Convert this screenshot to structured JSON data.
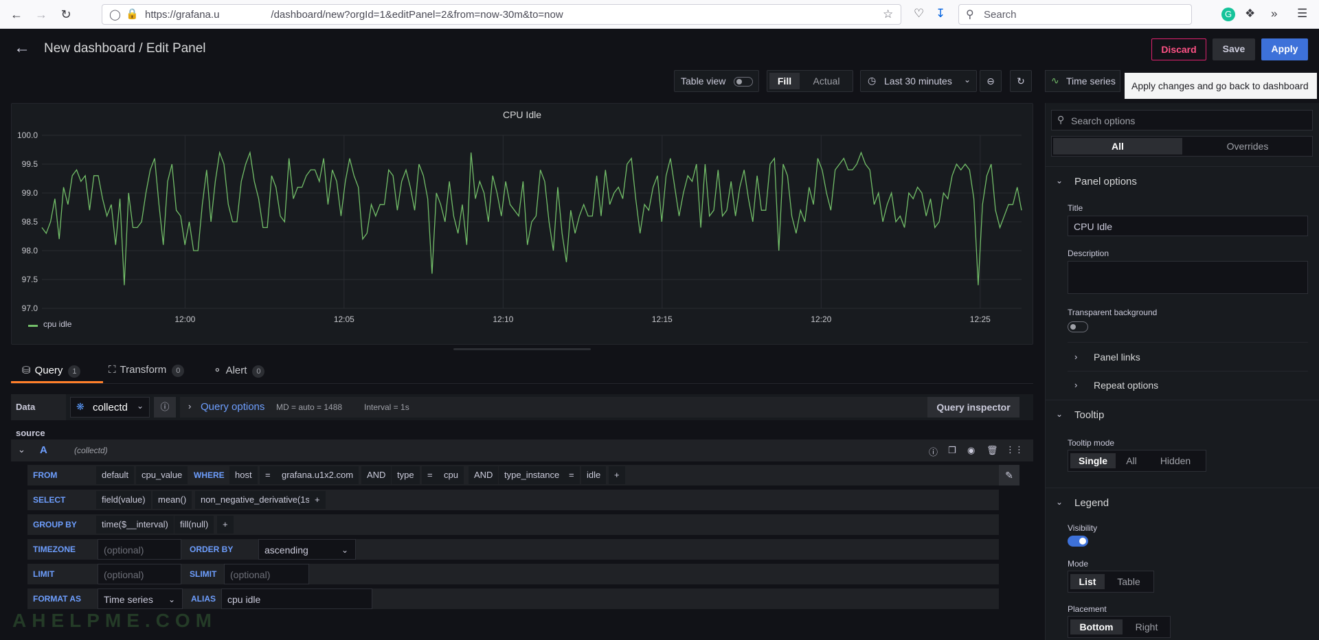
{
  "browser": {
    "url": "https://grafana.u     /dashboard/new?orgId=1&editPanel=2&from=now-30m&to=now",
    "search_placeholder": "Search"
  },
  "header": {
    "title": "New dashboard / Edit Panel",
    "discard_label": "Discard",
    "save_label": "Save",
    "apply_label": "Apply"
  },
  "toolbar": {
    "table_view_label": "Table view",
    "fill_label": "Fill",
    "actual_label": "Actual",
    "time_range_label": "Last 30 minutes",
    "viz_label": "Time series",
    "tooltip_text": "Apply changes and go back to dashboard"
  },
  "panel": {
    "title": "CPU Idle",
    "legend_label": "cpu idle"
  },
  "colors": {
    "series": "#73bf69",
    "accent": "#3d71d9",
    "danger": "#ff5286",
    "tab_active": "#ff7f2a"
  },
  "chart_data": {
    "type": "line",
    "title": "CPU Idle",
    "xlabel": "",
    "ylabel": "",
    "ylim": [
      97.0,
      100.0
    ],
    "yticks": [
      "100.0",
      "99.5",
      "99.0",
      "98.5",
      "98.0",
      "97.5",
      "97.0"
    ],
    "xticks": [
      "12:00",
      "12:05",
      "12:10",
      "12:15",
      "12:20",
      "12:25"
    ],
    "xlim_minutes": [
      -4.5,
      26.3
    ],
    "series": [
      {
        "name": "cpu idle",
        "values": [
          98.4,
          98.3,
          98.5,
          98.9,
          98.2,
          99.1,
          98.8,
          99.3,
          99.4,
          99.2,
          99.3,
          98.7,
          99.3,
          99.3,
          98.9,
          98.6,
          98.8,
          98.1,
          98.9,
          97.4,
          99.0,
          98.4,
          98.4,
          98.5,
          99.0,
          99.4,
          99.6,
          98.8,
          98.1,
          99.2,
          99.5,
          98.7,
          98.6,
          98.1,
          98.5,
          98.0,
          98.0,
          98.8,
          99.4,
          98.5,
          99.2,
          99.7,
          99.5,
          98.8,
          98.5,
          98.5,
          99.2,
          99.5,
          99.7,
          99.2,
          98.9,
          98.4,
          98.4,
          99.3,
          99.1,
          98.6,
          98.5,
          99.6,
          98.9,
          99.1,
          99.1,
          99.3,
          99.4,
          99.4,
          99.2,
          99.6,
          98.8,
          99.4,
          99.2,
          98.6,
          99.2,
          99.6,
          99.3,
          99.1,
          98.2,
          98.3,
          98.8,
          98.6,
          98.8,
          98.8,
          99.4,
          99.3,
          98.7,
          99.2,
          99.4,
          99.1,
          98.7,
          99.5,
          99.3,
          98.9,
          97.6,
          99.0,
          98.8,
          98.5,
          99.2,
          98.6,
          98.3,
          98.8,
          98.1,
          99.7,
          98.9,
          99.2,
          99.0,
          98.5,
          99.3,
          99.0,
          98.6,
          99.2,
          98.8,
          98.7,
          98.6,
          99.2,
          98.1,
          98.5,
          98.6,
          99.4,
          99.2,
          98.5,
          98.0,
          99.1,
          98.3,
          97.8,
          98.7,
          98.3,
          98.6,
          98.8,
          98.6,
          98.6,
          99.3,
          98.6,
          99.4,
          98.8,
          99.0,
          99.1,
          98.9,
          99.5,
          99.6,
          98.9,
          98.3,
          98.8,
          98.7,
          99.1,
          99.3,
          98.5,
          99.3,
          99.6,
          99.1,
          98.6,
          99.0,
          99.3,
          99.2,
          99.5,
          98.4,
          99.5,
          98.6,
          98.7,
          99.4,
          98.6,
          98.7,
          99.2,
          98.6,
          99.1,
          99.4,
          98.9,
          98.5,
          99.3,
          98.7,
          98.7,
          99.5,
          99.6,
          98.0,
          99.5,
          99.3,
          98.6,
          98.3,
          98.7,
          98.5,
          99.1,
          98.8,
          99.6,
          99.4,
          99.0,
          98.7,
          99.4,
          99.5,
          99.6,
          99.4,
          99.4,
          99.5,
          99.7,
          99.5,
          99.4,
          98.8,
          99.0,
          98.5,
          98.8,
          99.0,
          98.5,
          98.6,
          98.4,
          99.0,
          98.9,
          99.1,
          99.0,
          98.6,
          98.9,
          98.4,
          98.5,
          99.0,
          98.9,
          99.3,
          99.5,
          99.4,
          99.5,
          99.4,
          98.9,
          97.4,
          98.8,
          99.3,
          99.5,
          98.7,
          98.4,
          98.6,
          98.8,
          98.8,
          99.1,
          98.7
        ]
      }
    ]
  },
  "query_tabs": [
    {
      "label": "Query",
      "count": "1"
    },
    {
      "label": "Transform",
      "count": "0"
    },
    {
      "label": "Alert",
      "count": "0"
    }
  ],
  "datasource": {
    "label": "Data source",
    "name": "collectd",
    "query_options_label": "Query options",
    "md_label": "MD = auto = 1488",
    "interval_label": "Interval = 1s",
    "inspector_label": "Query inspector"
  },
  "query": {
    "ref_id": "A",
    "ds_hint": "(collectd)",
    "from_kw": "FROM",
    "from_parts": [
      "default",
      "cpu_value"
    ],
    "where_kw": "WHERE",
    "where_parts": [
      "host",
      "=",
      "grafana.u1x2.com",
      "AND",
      "type",
      "=",
      "cpu",
      "AND",
      "type_instance",
      "=",
      "idle",
      "+"
    ],
    "select_kw": "SELECT",
    "select_parts": [
      "field(value)",
      "mean()",
      "non_negative_derivative(1s)",
      "+"
    ],
    "groupby_kw": "GROUP BY",
    "groupby_parts": [
      "time($__interval)",
      "fill(null)",
      "+"
    ],
    "timezone_kw": "TIMEZONE",
    "timezone_placeholder": "(optional)",
    "orderby_kw": "ORDER BY TIME",
    "orderby_value": "ascending",
    "limit_kw": "LIMIT",
    "limit_placeholder": "(optional)",
    "slimit_kw": "SLIMIT",
    "slimit_placeholder": "(optional)",
    "format_kw": "FORMAT AS",
    "format_value": "Time series",
    "alias_kw": "ALIAS",
    "alias_value": "cpu idle"
  },
  "options": {
    "search_placeholder": "Search options",
    "tab_all": "All",
    "tab_overrides": "Overrides",
    "panel_options_label": "Panel options",
    "title_label": "Title",
    "title_value": "CPU Idle",
    "description_label": "Description",
    "transparent_label": "Transparent background",
    "panel_links_label": "Panel links",
    "repeat_options_label": "Repeat options",
    "tooltip_section": "Tooltip",
    "tooltip_mode_label": "Tooltip mode",
    "tooltip_modes": [
      "Single",
      "All",
      "Hidden"
    ],
    "legend_section": "Legend",
    "visibility_label": "Visibility",
    "mode_label": "Mode",
    "modes": [
      "List",
      "Table"
    ],
    "placement_label": "Placement",
    "placements": [
      "Bottom",
      "Right"
    ]
  },
  "watermark": "AHELPME.COM"
}
